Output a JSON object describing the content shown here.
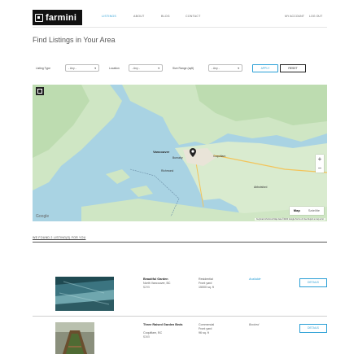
{
  "header": {
    "logo_text": "farmini",
    "nav": [
      "LISTINGS",
      "ABOUT",
      "BLOG",
      "CONTACT"
    ],
    "account": "MY ACCOUNT",
    "logout": "LOG OUT",
    "accent": "#2a9fd6"
  },
  "page": {
    "title": "Find Listings in Your Area"
  },
  "filters": {
    "type_label": "Listing Type",
    "type_value": "- Any -",
    "location_label": "Location",
    "location_value": "- Any -",
    "size_label": "Size Range (sqft)",
    "size_value": "- Any -",
    "apply": "APPLY",
    "reset": "RESET"
  },
  "map": {
    "labels": [
      "Vancouver",
      "Burnaby",
      "Coquitlam",
      "Abbotsford",
      "Richmond"
    ],
    "map_btn": "Map",
    "satellite_btn": "Satellite",
    "google": "Google",
    "attribution": "Keyboard shortcuts  Map data ©2022 Google  Terms of Use  Report a map error"
  },
  "results": {
    "summary": "WE FOUND 2 LISTING(S) FOR YOU",
    "items": [
      {
        "name": "Beautiful Garden",
        "location": "North Vancouver, BC",
        "price": "$295",
        "category": "Residential",
        "yard": "Front yard",
        "size": "15000 sq. ft",
        "status": "Available",
        "status_color": "#2a9fd6",
        "details": "DETAILS"
      },
      {
        "name": "Three Raised Garden Beds",
        "location": "Coquitlam, BC",
        "price": "$365",
        "category": "Commercial",
        "yard": "Front yard",
        "size": "96 sq. ft",
        "status": "Booked",
        "status_color": "#666666",
        "details": "DETAILS"
      }
    ]
  }
}
